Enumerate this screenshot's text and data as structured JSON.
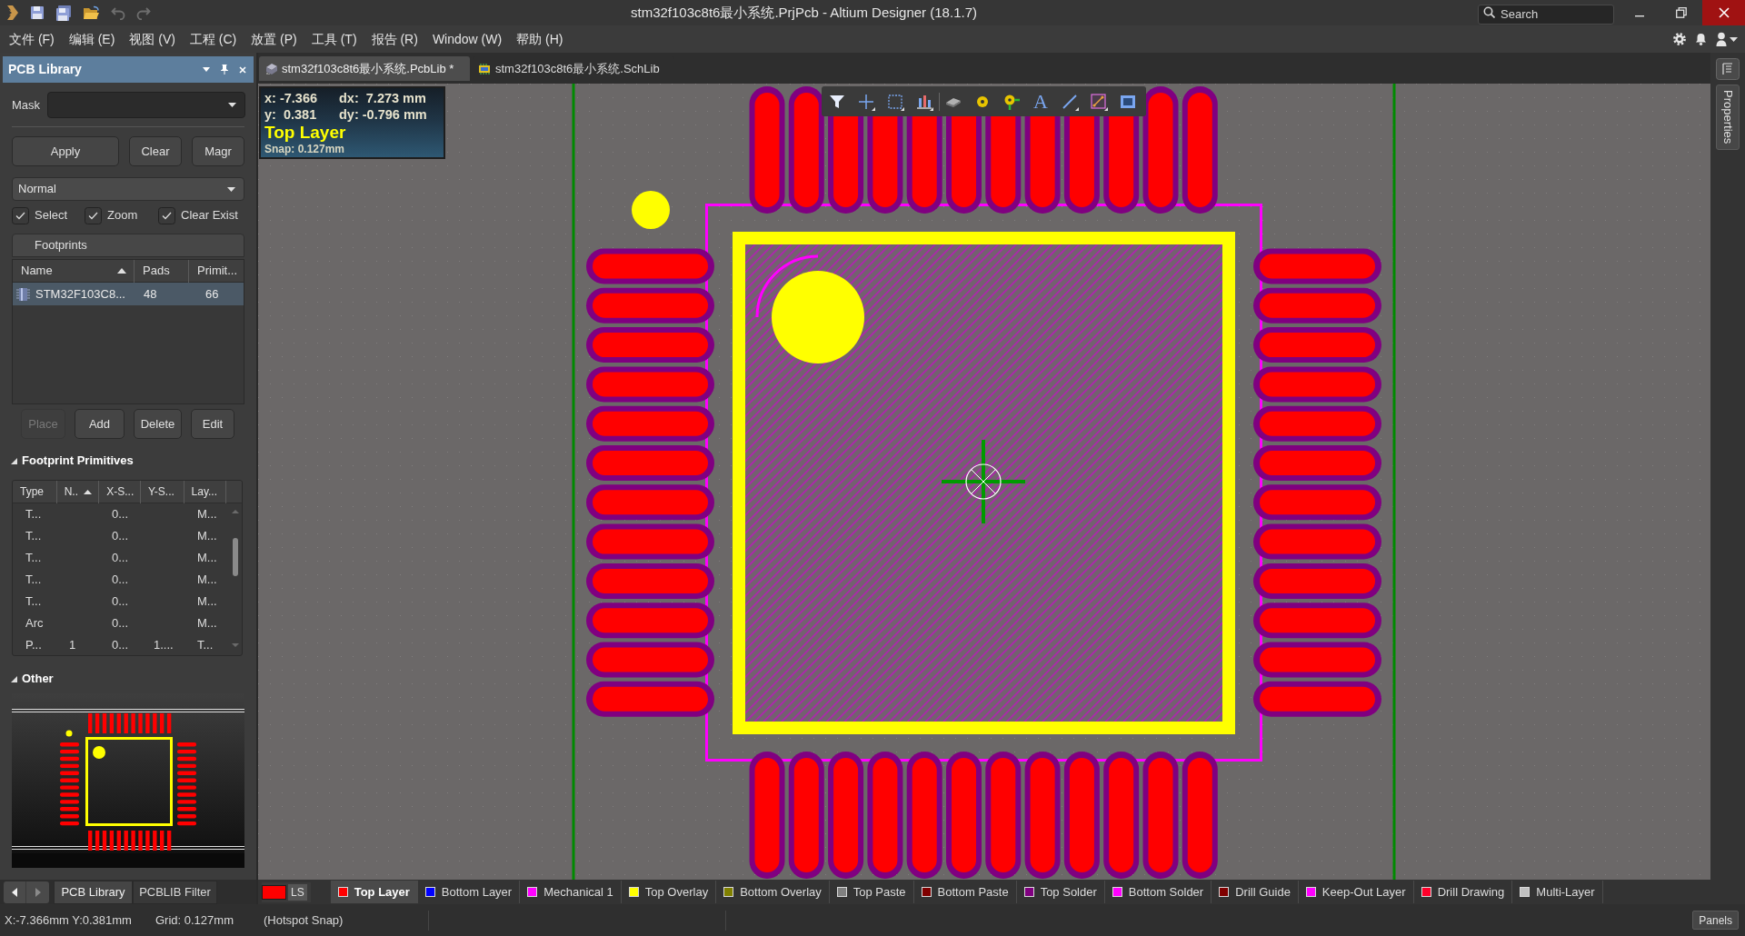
{
  "title_bar": {
    "title": "stm32f103c8t6最小系统.PrjPcb - Altium Designer (18.1.7)",
    "search": {
      "placeholder": "Search"
    }
  },
  "menu": [
    "文件 (F)",
    "编辑 (E)",
    "视图 (V)",
    "工程 (C)",
    "放置 (P)",
    "工具 (T)",
    "报告 (R)",
    "Window (W)",
    "帮助 (H)"
  ],
  "pcb_library_panel": {
    "title": "PCB Library",
    "mask": {
      "label": "Mask"
    },
    "filter_buttons": [
      "Apply",
      "Clear",
      "Magr"
    ],
    "mode": {
      "value": "Normal"
    },
    "options": [
      {
        "label": "Select",
        "checked": true
      },
      {
        "label": "Zoom",
        "checked": true
      },
      {
        "label": "Clear Exist",
        "checked": true
      }
    ],
    "footprints": {
      "title": "Footprints",
      "columns": [
        "Name",
        "Pads",
        "Primit..."
      ],
      "rows": [
        {
          "cells": [
            "STM32F103C8...",
            "48",
            "66"
          ],
          "selected": true
        }
      ]
    },
    "actions": [
      {
        "label": "Place",
        "disabled": true
      },
      {
        "label": "Add",
        "disabled": false
      },
      {
        "label": "Delete",
        "disabled": false
      },
      {
        "label": "Edit",
        "disabled": false
      }
    ],
    "primitives": {
      "title": "Footprint Primitives",
      "expanded": true,
      "columns": [
        "Type",
        "N..",
        "X-S...",
        "Y-S...",
        "Lay..."
      ],
      "rows": [
        {
          "type": "T...",
          "column_3": "0...",
          "column_5": "M..."
        },
        {
          "type": "T...",
          "column_3": "0...",
          "column_5": "M..."
        },
        {
          "type": "T...",
          "column_3": "0...",
          "column_5": "M..."
        },
        {
          "type": "T...",
          "column_3": "0...",
          "column_5": "M..."
        },
        {
          "type": "T...",
          "column_3": "0...",
          "column_5": "M..."
        },
        {
          "type": "Arc",
          "column_3": "0...",
          "column_5": "M..."
        },
        {
          "type": "P...",
          "column_2": "1",
          "column_3": "0...",
          "column_4": "1....",
          "column_5": "T..."
        }
      ]
    },
    "other": {
      "title": "Other",
      "expanded": true
    }
  },
  "panel_tabs": [
    {
      "label": "PCB Library",
      "selected": true
    },
    {
      "label": "PCBLIB Filter",
      "selected": false
    }
  ],
  "document_tabs": [
    {
      "label": "stm32f103c8t6最小系统.PcbLib *",
      "selected": true
    },
    {
      "label": "stm32f103c8t6最小系统.SchLib",
      "selected": false
    }
  ],
  "canvas": {
    "hud": {
      "x": "x: -7.366",
      "dx": "dx:  7.273 mm",
      "y": "y:  0.381",
      "dy": "dy: -0.796 mm",
      "layer": "Top Layer",
      "snap": "Snap: 0.127mm"
    },
    "toolbar": {
      "text_tool": "A"
    }
  },
  "layer_tabs": {
    "layer_set": {
      "label": "LS",
      "color": "#ff0000"
    },
    "layers": [
      {
        "label": "Top Layer",
        "color": "#ff0000",
        "selected": true
      },
      {
        "label": "Bottom Layer",
        "color": "#0000ff",
        "selected": false
      },
      {
        "label": "Mechanical 1",
        "color": "#ff00ff",
        "selected": false
      },
      {
        "label": "Top Overlay",
        "color": "#ffff00",
        "selected": false
      },
      {
        "label": "Bottom Overlay",
        "color": "#808000",
        "selected": false
      },
      {
        "label": "Top Paste",
        "color": "#808080",
        "selected": false
      },
      {
        "label": "Bottom Paste",
        "color": "#800000",
        "selected": false
      },
      {
        "label": "Top Solder",
        "color": "#800080",
        "selected": false
      },
      {
        "label": "Bottom Solder",
        "color": "#ff00ff",
        "selected": false
      },
      {
        "label": "Drill Guide",
        "color": "#800000",
        "selected": false
      },
      {
        "label": "Keep-Out Layer",
        "color": "#ff00ff",
        "selected": false
      },
      {
        "label": "Drill Drawing",
        "color": "#ff002a",
        "selected": false
      },
      {
        "label": "Multi-Layer",
        "color": "#c0c0c0",
        "selected": false
      }
    ]
  },
  "right_panel": {
    "properties_tab": "Properties"
  },
  "status_bar": {
    "position": "X:-7.366mm Y:0.381mm",
    "grid": "Grid: 0.127mm",
    "snap_mode": "(Hotspot Snap)",
    "panels_button": "Panels"
  }
}
